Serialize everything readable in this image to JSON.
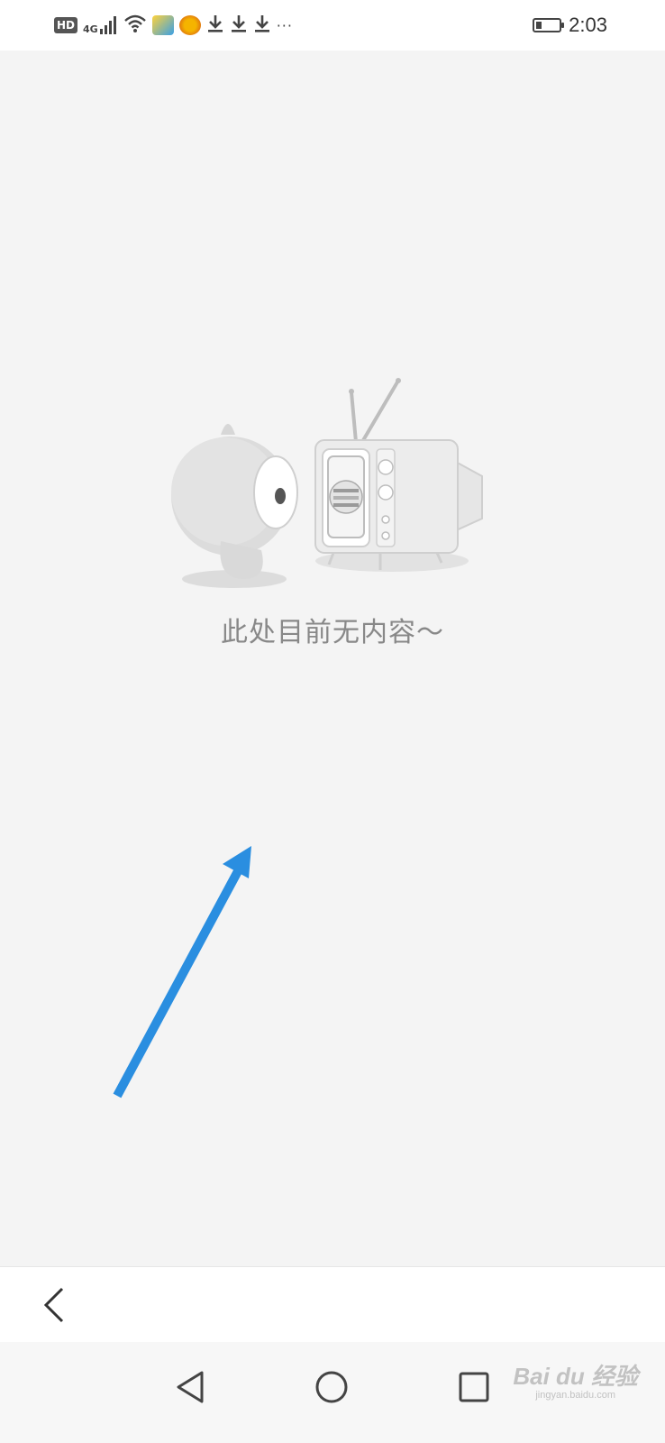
{
  "status_bar": {
    "left_icons": [
      "hd-icon",
      "signal-4g-icon",
      "wifi-icon",
      "app-notification-icon",
      "app-notification-icon-2",
      "download-icon",
      "download-icon",
      "download-icon",
      "more-notifications-icon"
    ],
    "hd_label": "HD",
    "network_label": "4G",
    "more": "···",
    "battery_level": 0.25,
    "time": "2:03"
  },
  "empty_state": {
    "message": "此处目前无内容～",
    "illustration": "mascot-watching-tv"
  },
  "annotation": {
    "arrow_color": "#2a8ee0"
  },
  "app_bottom_bar": {
    "back_icon": "chevron-left-icon"
  },
  "system_nav": {
    "buttons": [
      "back-triangle-icon",
      "home-circle-icon",
      "recents-square-icon"
    ]
  },
  "watermark": {
    "brand": "Bai du 经验",
    "site": "jingyan.baidu.com"
  },
  "colors": {
    "background": "#f4f4f4",
    "text_muted": "#888888",
    "arrow": "#2a8ee0"
  }
}
